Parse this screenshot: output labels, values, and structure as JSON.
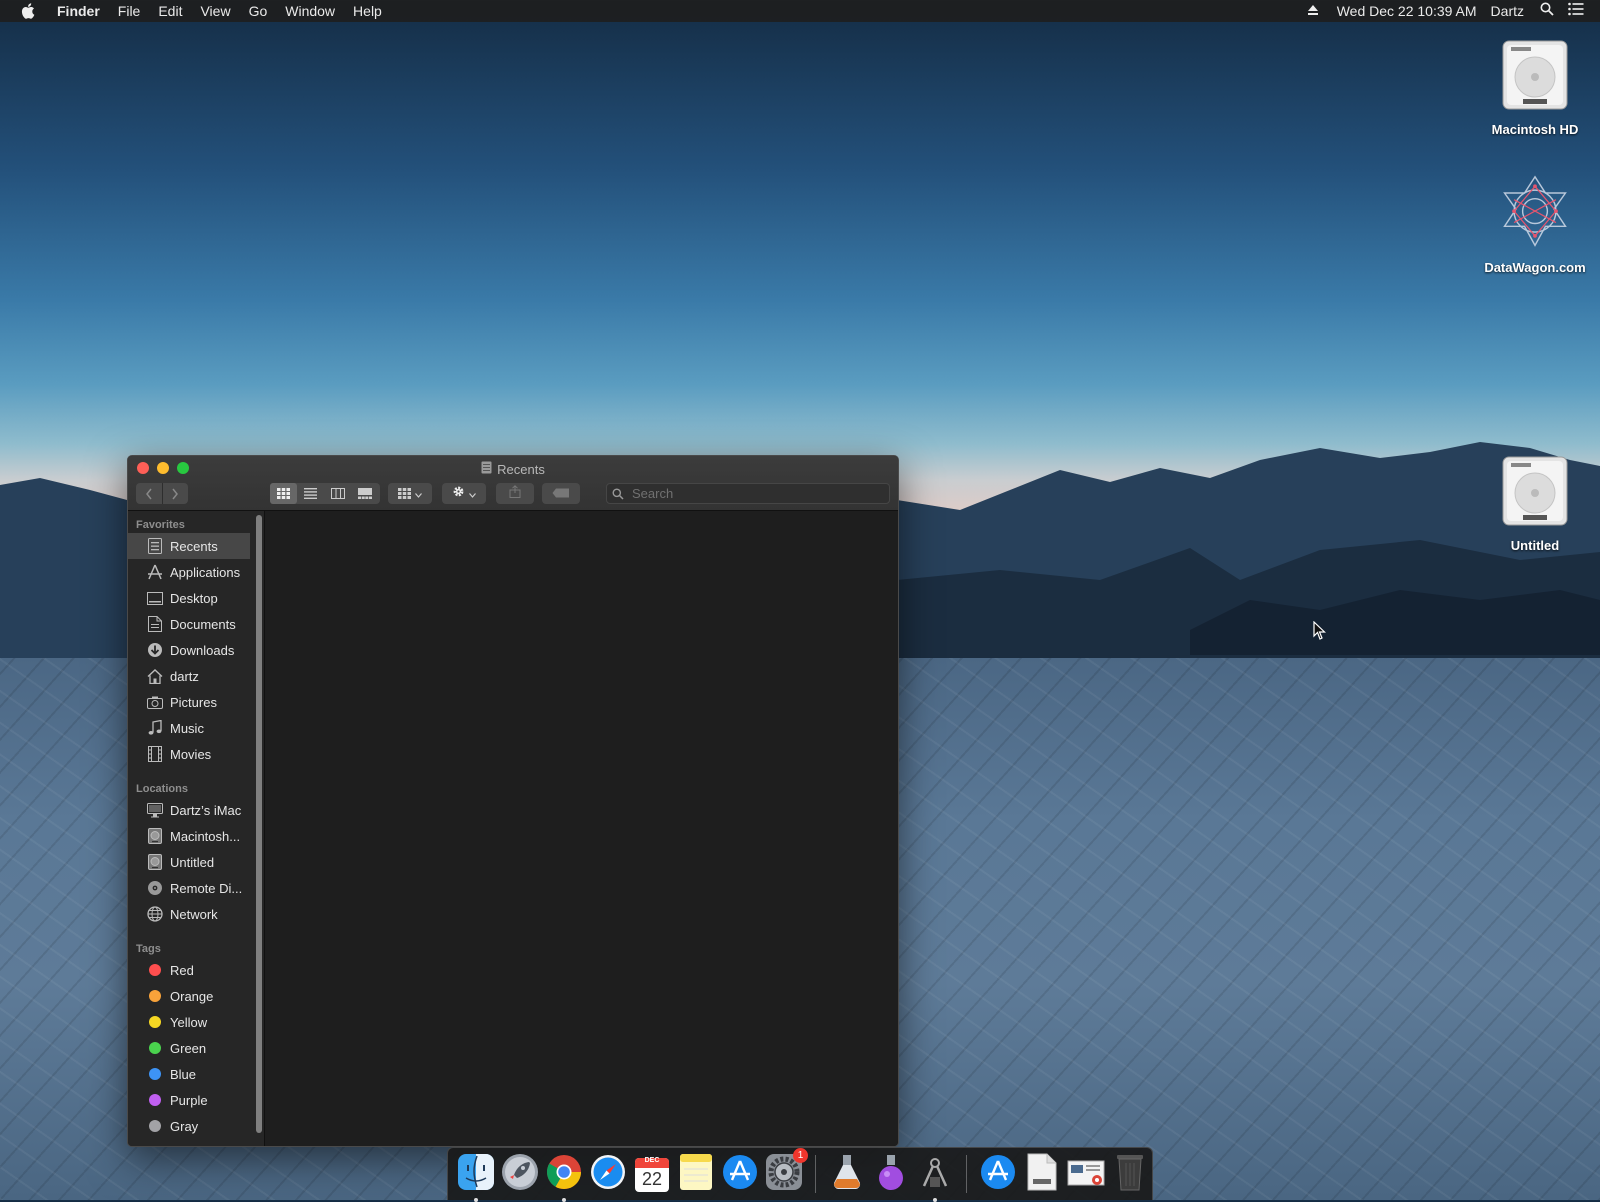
{
  "menubar": {
    "app_name": "Finder",
    "menus": [
      "File",
      "Edit",
      "View",
      "Go",
      "Window",
      "Help"
    ],
    "datetime": "Wed Dec 22  10:39 AM",
    "user": "Dartz"
  },
  "desktop_icons": [
    {
      "label": "Macintosh HD",
      "icon": "hard-drive-icon"
    },
    {
      "label": "DataWagon.com",
      "icon": "datawagon-logo"
    },
    {
      "label": "Untitled",
      "icon": "hard-drive-icon"
    }
  ],
  "finder": {
    "title": "Recents",
    "search_placeholder": "Search",
    "sections": {
      "favorites": "Favorites",
      "locations": "Locations",
      "tags": "Tags"
    },
    "favorites": [
      {
        "label": "Recents",
        "icon": "recents-icon",
        "selected": true
      },
      {
        "label": "Applications",
        "icon": "applications-icon"
      },
      {
        "label": "Desktop",
        "icon": "desktop-icon"
      },
      {
        "label": "Documents",
        "icon": "documents-icon"
      },
      {
        "label": "Downloads",
        "icon": "downloads-icon"
      },
      {
        "label": "dartz",
        "icon": "home-icon"
      },
      {
        "label": "Pictures",
        "icon": "camera-icon"
      },
      {
        "label": "Music",
        "icon": "music-note-icon"
      },
      {
        "label": "Movies",
        "icon": "film-icon"
      }
    ],
    "locations": [
      {
        "label": "Dartz’s iMac",
        "icon": "imac-icon"
      },
      {
        "label": "Macintosh...",
        "icon": "disk-icon"
      },
      {
        "label": "Untitled",
        "icon": "disk-icon"
      },
      {
        "label": "Remote Di...",
        "icon": "remote-disc-icon"
      },
      {
        "label": "Network",
        "icon": "network-globe-icon"
      }
    ],
    "tags": [
      {
        "label": "Red",
        "color": "#fe4e4e"
      },
      {
        "label": "Orange",
        "color": "#f8a23a"
      },
      {
        "label": "Yellow",
        "color": "#f5d723"
      },
      {
        "label": "Green",
        "color": "#4ad24e"
      },
      {
        "label": "Blue",
        "color": "#3d93f5"
      },
      {
        "label": "Purple",
        "color": "#c05ff0"
      },
      {
        "label": "Gray",
        "color": "#a2a2a6"
      }
    ]
  },
  "dock": {
    "badge_count": "1",
    "calendar_month": "DEC",
    "calendar_day": "22"
  }
}
